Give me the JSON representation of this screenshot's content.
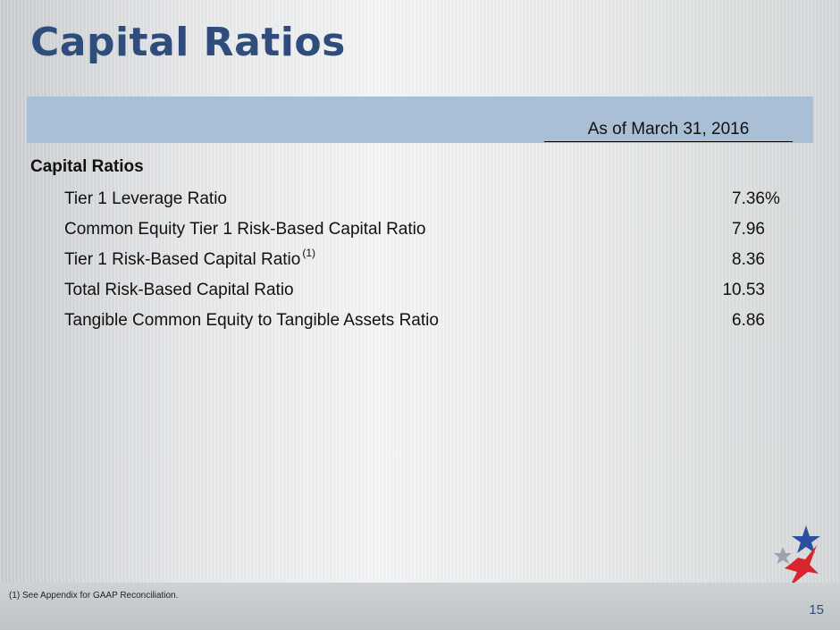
{
  "slide": {
    "title": "Capital Ratios",
    "column_header": "As of March 31, 2016",
    "section_label": "Capital Ratios",
    "rows": [
      {
        "label": "Tier 1 Leverage Ratio",
        "footnote_ref": "",
        "value": "7.36",
        "suffix": "%"
      },
      {
        "label": "Common Equity Tier 1 Risk-Based Capital Ratio",
        "footnote_ref": "",
        "value": "7.96",
        "suffix": ""
      },
      {
        "label": "Tier 1 Risk-Based Capital Ratio",
        "footnote_ref": "(1)",
        "value": "8.36",
        "suffix": ""
      },
      {
        "label": "Total Risk-Based Capital Ratio",
        "footnote_ref": "",
        "value": "10.53",
        "suffix": ""
      },
      {
        "label": "Tangible Common Equity to Tangible Assets Ratio",
        "footnote_ref": "",
        "value": "6.86",
        "suffix": ""
      }
    ],
    "footnote": "(1)    See Appendix for GAAP Reconciliation.",
    "page_number": "15"
  },
  "colors": {
    "title": "#2e4d7c",
    "band": "#a9bfd6",
    "logo_blue": "#2c4f9e",
    "logo_red": "#d9262e"
  },
  "icons": {
    "logo": "star-logo-icon"
  }
}
